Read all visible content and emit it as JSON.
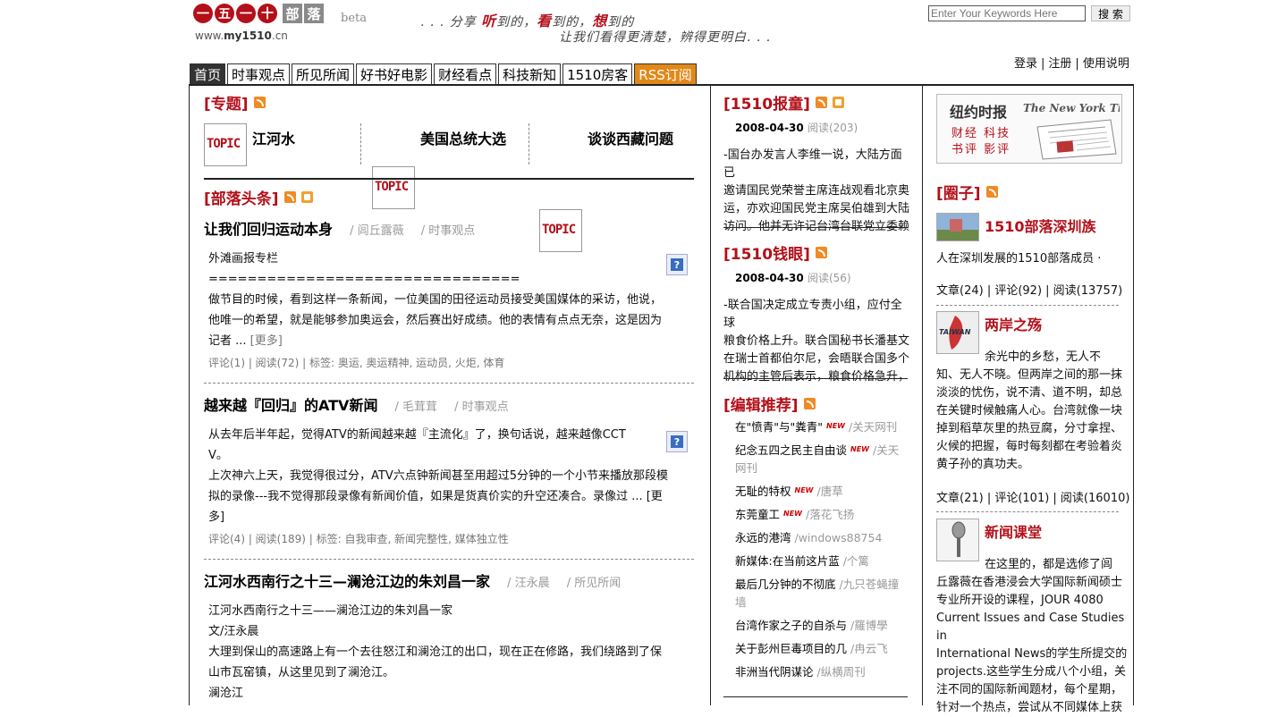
{
  "header": {
    "logo_chars": [
      "一",
      "五",
      "一",
      "十"
    ],
    "logo_grey_chars": [
      "部",
      "落"
    ],
    "logo_beta": "beta",
    "logo_url_prefix": "www.",
    "logo_url_bold": "my1510",
    "logo_url_suffix": ".cn",
    "slogan_prefix": ". . . 分享 ",
    "slogan_k1": "听",
    "slogan_t1": "到的，",
    "slogan_k2": "看",
    "slogan_t2": "到的，",
    "slogan_k3": "想",
    "slogan_t3": "到的",
    "slogan_line2": "让我们看得更清楚，辨得更明白. . .",
    "search_placeholder": "Enter Your Keywords Here",
    "search_button": "搜 索",
    "user_links": [
      "登录",
      "注册",
      "使用说明"
    ]
  },
  "nav": {
    "tabs": [
      "首页",
      "时事观点",
      "所见所闻",
      "好书好电影",
      "财经看点",
      "科技新知",
      "1510房客",
      "RSS订阅"
    ]
  },
  "topics": {
    "heading": "[专题]",
    "img_text": "TOPIC",
    "items": [
      "江河水",
      "美国总统大选",
      "谈谈西藏问题"
    ]
  },
  "headlines": {
    "heading": "[部落头条]",
    "articles": [
      {
        "title": "让我们回归运动本身",
        "author": "/ 闾丘露薇",
        "category": "/ 时事观点",
        "lines": [
          "外滩画报专栏",
          "================================",
          "做节目的时候，看到这样一条新闻，一位美国的田径运动员接受美国媒体的采访，他说，",
          "他唯一的希望，就是能够参加奥运会，然后赛出好成绩。他的表情有点点无奈，这是因为",
          "记者 ...  "
        ],
        "more": "[更多]",
        "stats": "评论(1) | 阅读(72) | 标签: 奥运, 奥运精神, 运动员, 火炬, 体育"
      },
      {
        "title": "越来越『回归』的ATV新闻",
        "author": "/ 毛茸茸",
        "category": "/ 时事观点",
        "lines": [
          "从去年后半年起，觉得ATV的新闻越来越『主流化』了，换句话说，越来越像CCT",
          "V。",
          "上次神六上天，我觉得很过分，ATV六点钟新闻甚至用超过5分钟的一个小节来播放那段模",
          "拟的录像---我不觉得那段录像有新闻价值，如果是货真价实的升空还凑合。录像过 ...  [更",
          "多]"
        ],
        "more": "",
        "stats": "评论(4) | 阅读(189) | 标签: 自我审查, 新闻完整性, 媒体独立性"
      },
      {
        "title": "江河水西南行之十三—澜沧江边的朱刘昌一家",
        "author": "/ 汪永晨",
        "category": "/ 所见所闻",
        "lines": [
          "江河水西南行之十三——澜沧江边的朱刘昌一家",
          "文/汪永晨",
          "大理到保山的高速路上有一个去往怒江和澜沧江的出口，现在正在修路，我们绕路到了保",
          "山市瓦窑镇，从这里见到了澜沧江。",
          "澜沧江"
        ],
        "more": "",
        "stats": ""
      }
    ]
  },
  "reports": {
    "heading": "[1510报童]",
    "date": "2008-04-30",
    "reads": "阅读(203)",
    "lines": [
      "-国台办发言人李维一说，大陆方面已",
      "邀请国民党荣誉主席连战观看北京奥",
      "运，亦欢迎国民党主席吴伯雄到大陆",
      "访问。他并无许记台湾台联党立委赖"
    ]
  },
  "money": {
    "heading": "[1510钱眼]",
    "date": "2008-04-30",
    "reads": "阅读(56)",
    "lines": [
      "-联合国决定成立专责小组，应付全球",
      "粮食价格上升。联合国秘书长潘基文",
      "在瑞士首都伯尔尼，会晤联合国多个",
      "机构的主管后表示，粮食价格急升，"
    ]
  },
  "editor": {
    "heading": "[编辑推荐]",
    "new_label": "NEW",
    "items": [
      {
        "title": "在\"愤青\"与\"粪青\"",
        "new": true,
        "src": "/关天网刊"
      },
      {
        "title": "纪念五四之民主自由谈",
        "new": true,
        "src": "/关天网刊"
      },
      {
        "title": "无耻的特权",
        "new": true,
        "src": "/唐草"
      },
      {
        "title": "东莞童工",
        "new": true,
        "src": "/落花飞扬"
      },
      {
        "title": "永远的港湾",
        "new": false,
        "src": "/windows88754"
      },
      {
        "title": "新媒体:在当前这片蓝",
        "new": false,
        "src": "/个篱"
      },
      {
        "title": "最后几分钟的不彻底",
        "new": false,
        "src": "/九只苍蝇撞墙"
      },
      {
        "title": "台湾作家之子的自杀与",
        "new": false,
        "src": "/羅博學"
      },
      {
        "title": "关于彭州巨毒项目的几",
        "new": false,
        "src": "/冉云飞"
      },
      {
        "title": "非洲当代阴谋论",
        "new": false,
        "src": "/纵横周刊"
      }
    ]
  },
  "nyt": {
    "title": "纽约时报",
    "logo": "The New York Times",
    "links1": [
      "财经",
      "科技"
    ],
    "links2": [
      "书评",
      "影评"
    ]
  },
  "circles": {
    "heading": "[圈子]",
    "groups": [
      {
        "name": "1510部落深圳族",
        "lines": [
          "人在深圳发展的1510部落成员 ·"
        ],
        "stats": "文章(24) | 评论(92) | 阅读(13757)"
      },
      {
        "name": "两岸之殇",
        "thumb_text": "TAIWAN",
        "lines": [
          "余光中的乡愁，无人不",
          "知、无人不晓。但两岸之间的那一抹",
          "淡淡的忧伤，说不清、道不明，却总",
          "在关键时候触痛人心。台湾就像一块",
          "掉到稻草灰里的热豆腐，分寸拿捏、",
          "火候的把握，每时每刻都在考验着炎",
          "黄子孙的真功夫。"
        ],
        "stats": "文章(21) | 评论(101) | 阅读(16010)"
      },
      {
        "name": "新闻课堂",
        "lines": [
          "在这里的，都是选修了闾",
          "丘露薇在香港浸会大学国际新闻硕士",
          "专业所开设的课程，JOUR 4080",
          "Current Issues and Case Studies in",
          "International News的学生所提交的",
          "projects.这些学生分成八个小组，关",
          "注不同的国际新闻题材，每个星期，",
          "针对一个热点，尝试从不同媒体上获"
        ],
        "stats": ""
      }
    ]
  }
}
